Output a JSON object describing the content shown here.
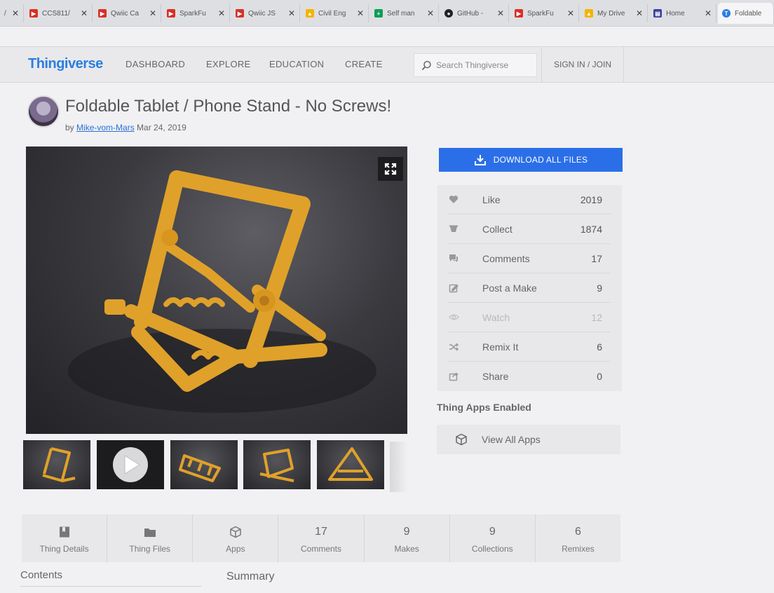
{
  "browser": {
    "tabs": [
      {
        "title": "/",
        "icon": "pdf-icon",
        "color": "#d93025"
      },
      {
        "title": "CCS811/",
        "icon": "pdf-icon",
        "color": "#d93025"
      },
      {
        "title": "Qwiic Ca",
        "icon": "pdf-icon",
        "color": "#d93025"
      },
      {
        "title": "SparkFu",
        "icon": "pdf-icon",
        "color": "#d93025"
      },
      {
        "title": "Qwiic JS",
        "icon": "pdf-icon",
        "color": "#d93025"
      },
      {
        "title": "Civil Eng",
        "icon": "google-drive-icon",
        "color": "#f4b400"
      },
      {
        "title": "Self man",
        "icon": "google-sheets-icon",
        "color": "#0f9d58"
      },
      {
        "title": "GitHub -",
        "icon": "github-icon",
        "color": "#222222"
      },
      {
        "title": "SparkFu",
        "icon": "pdf-icon",
        "color": "#d93025"
      },
      {
        "title": "My Drive",
        "icon": "google-drive-icon",
        "color": "#f4b400"
      },
      {
        "title": "Home",
        "icon": "forms-icon",
        "color": "#3c3fa0"
      },
      {
        "title": "Foldable",
        "icon": "thingiverse-icon",
        "color": "#2a7fe0"
      }
    ],
    "close_glyph": "✕"
  },
  "header": {
    "logo": "Thingiverse",
    "nav": [
      "DASHBOARD",
      "EXPLORE",
      "EDUCATION",
      "CREATE"
    ],
    "search_placeholder": "Search Thingiverse",
    "signin": "SIGN IN / JOIN"
  },
  "thing": {
    "title": "Foldable Tablet / Phone Stand - No Screws!",
    "by": "by",
    "author": "Mike-vom-Mars",
    "date": "Mar 24, 2019"
  },
  "actions": {
    "download": "DOWNLOAD ALL FILES",
    "stats": [
      {
        "icon": "heart-icon",
        "label": "Like",
        "value": "2019",
        "dim": false
      },
      {
        "icon": "collect-icon",
        "label": "Collect",
        "value": "1874",
        "dim": false
      },
      {
        "icon": "comments-icon",
        "label": "Comments",
        "value": "17",
        "dim": false
      },
      {
        "icon": "post-make-icon",
        "label": "Post a Make",
        "value": "9",
        "dim": false
      },
      {
        "icon": "eye-icon",
        "label": "Watch",
        "value": "12",
        "dim": true
      },
      {
        "icon": "remix-icon",
        "label": "Remix It",
        "value": "6",
        "dim": false
      },
      {
        "icon": "share-icon",
        "label": "Share",
        "value": "0",
        "dim": false
      }
    ],
    "apps_heading": "Thing Apps Enabled",
    "view_all_apps": "View All Apps"
  },
  "tabs": [
    {
      "top_icon": "thing-details-icon",
      "label": "Thing Details"
    },
    {
      "top_icon": "folder-icon",
      "label": "Thing Files"
    },
    {
      "top_icon": "apps-cube-icon",
      "label": "Apps"
    },
    {
      "top_value": "17",
      "label": "Comments"
    },
    {
      "top_value": "9",
      "label": "Makes"
    },
    {
      "top_value": "9",
      "label": "Collections"
    },
    {
      "top_value": "6",
      "label": "Remixes"
    }
  ],
  "sections": {
    "contents": "Contents",
    "summary": "Summary"
  },
  "colors": {
    "accent": "#2b6fe8",
    "logo": "#2a7fe0",
    "stand": "#e0a12a"
  }
}
